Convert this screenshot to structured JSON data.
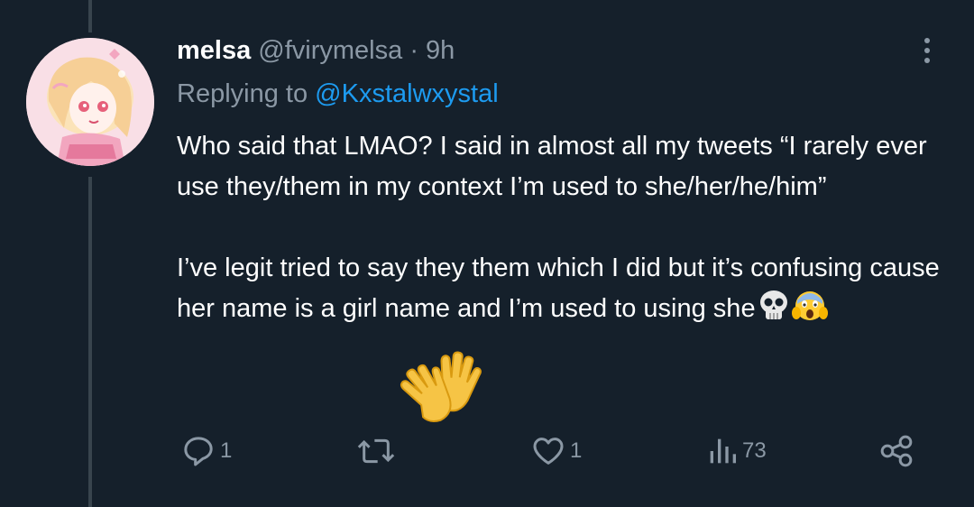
{
  "tweet": {
    "display_name": "melsa",
    "handle": "@fvirymelsa",
    "separator": "·",
    "time": "9h",
    "replying_prefix": "Replying to ",
    "replying_to": "@Kxstalwxystal",
    "paragraph_1": "Who said that LMAO? I said in almost all my tweets “I rarely ever use they/them in my context I’m used to she/her/he/him”",
    "paragraph_2": "I’ve legit tried to say they them which I did but it’s confusing cause her name is a girl name and I’m used to using she"
  },
  "emojis": [
    "skull-emoji",
    "screaming-face-emoji",
    "waving-hand-emoji",
    "waving-hand-emoji"
  ],
  "actions": {
    "reply_count": "1",
    "retweet_count": "",
    "like_count": "1",
    "views_count": "73"
  },
  "icons": [
    "more-icon",
    "reply-icon",
    "retweet-icon",
    "like-icon",
    "views-icon",
    "share-icon"
  ],
  "colors": {
    "background": "#15202b",
    "text": "#ffffff",
    "secondary_text": "#8b98a5",
    "link": "#1d9bf0",
    "thread_line": "#38444d"
  }
}
